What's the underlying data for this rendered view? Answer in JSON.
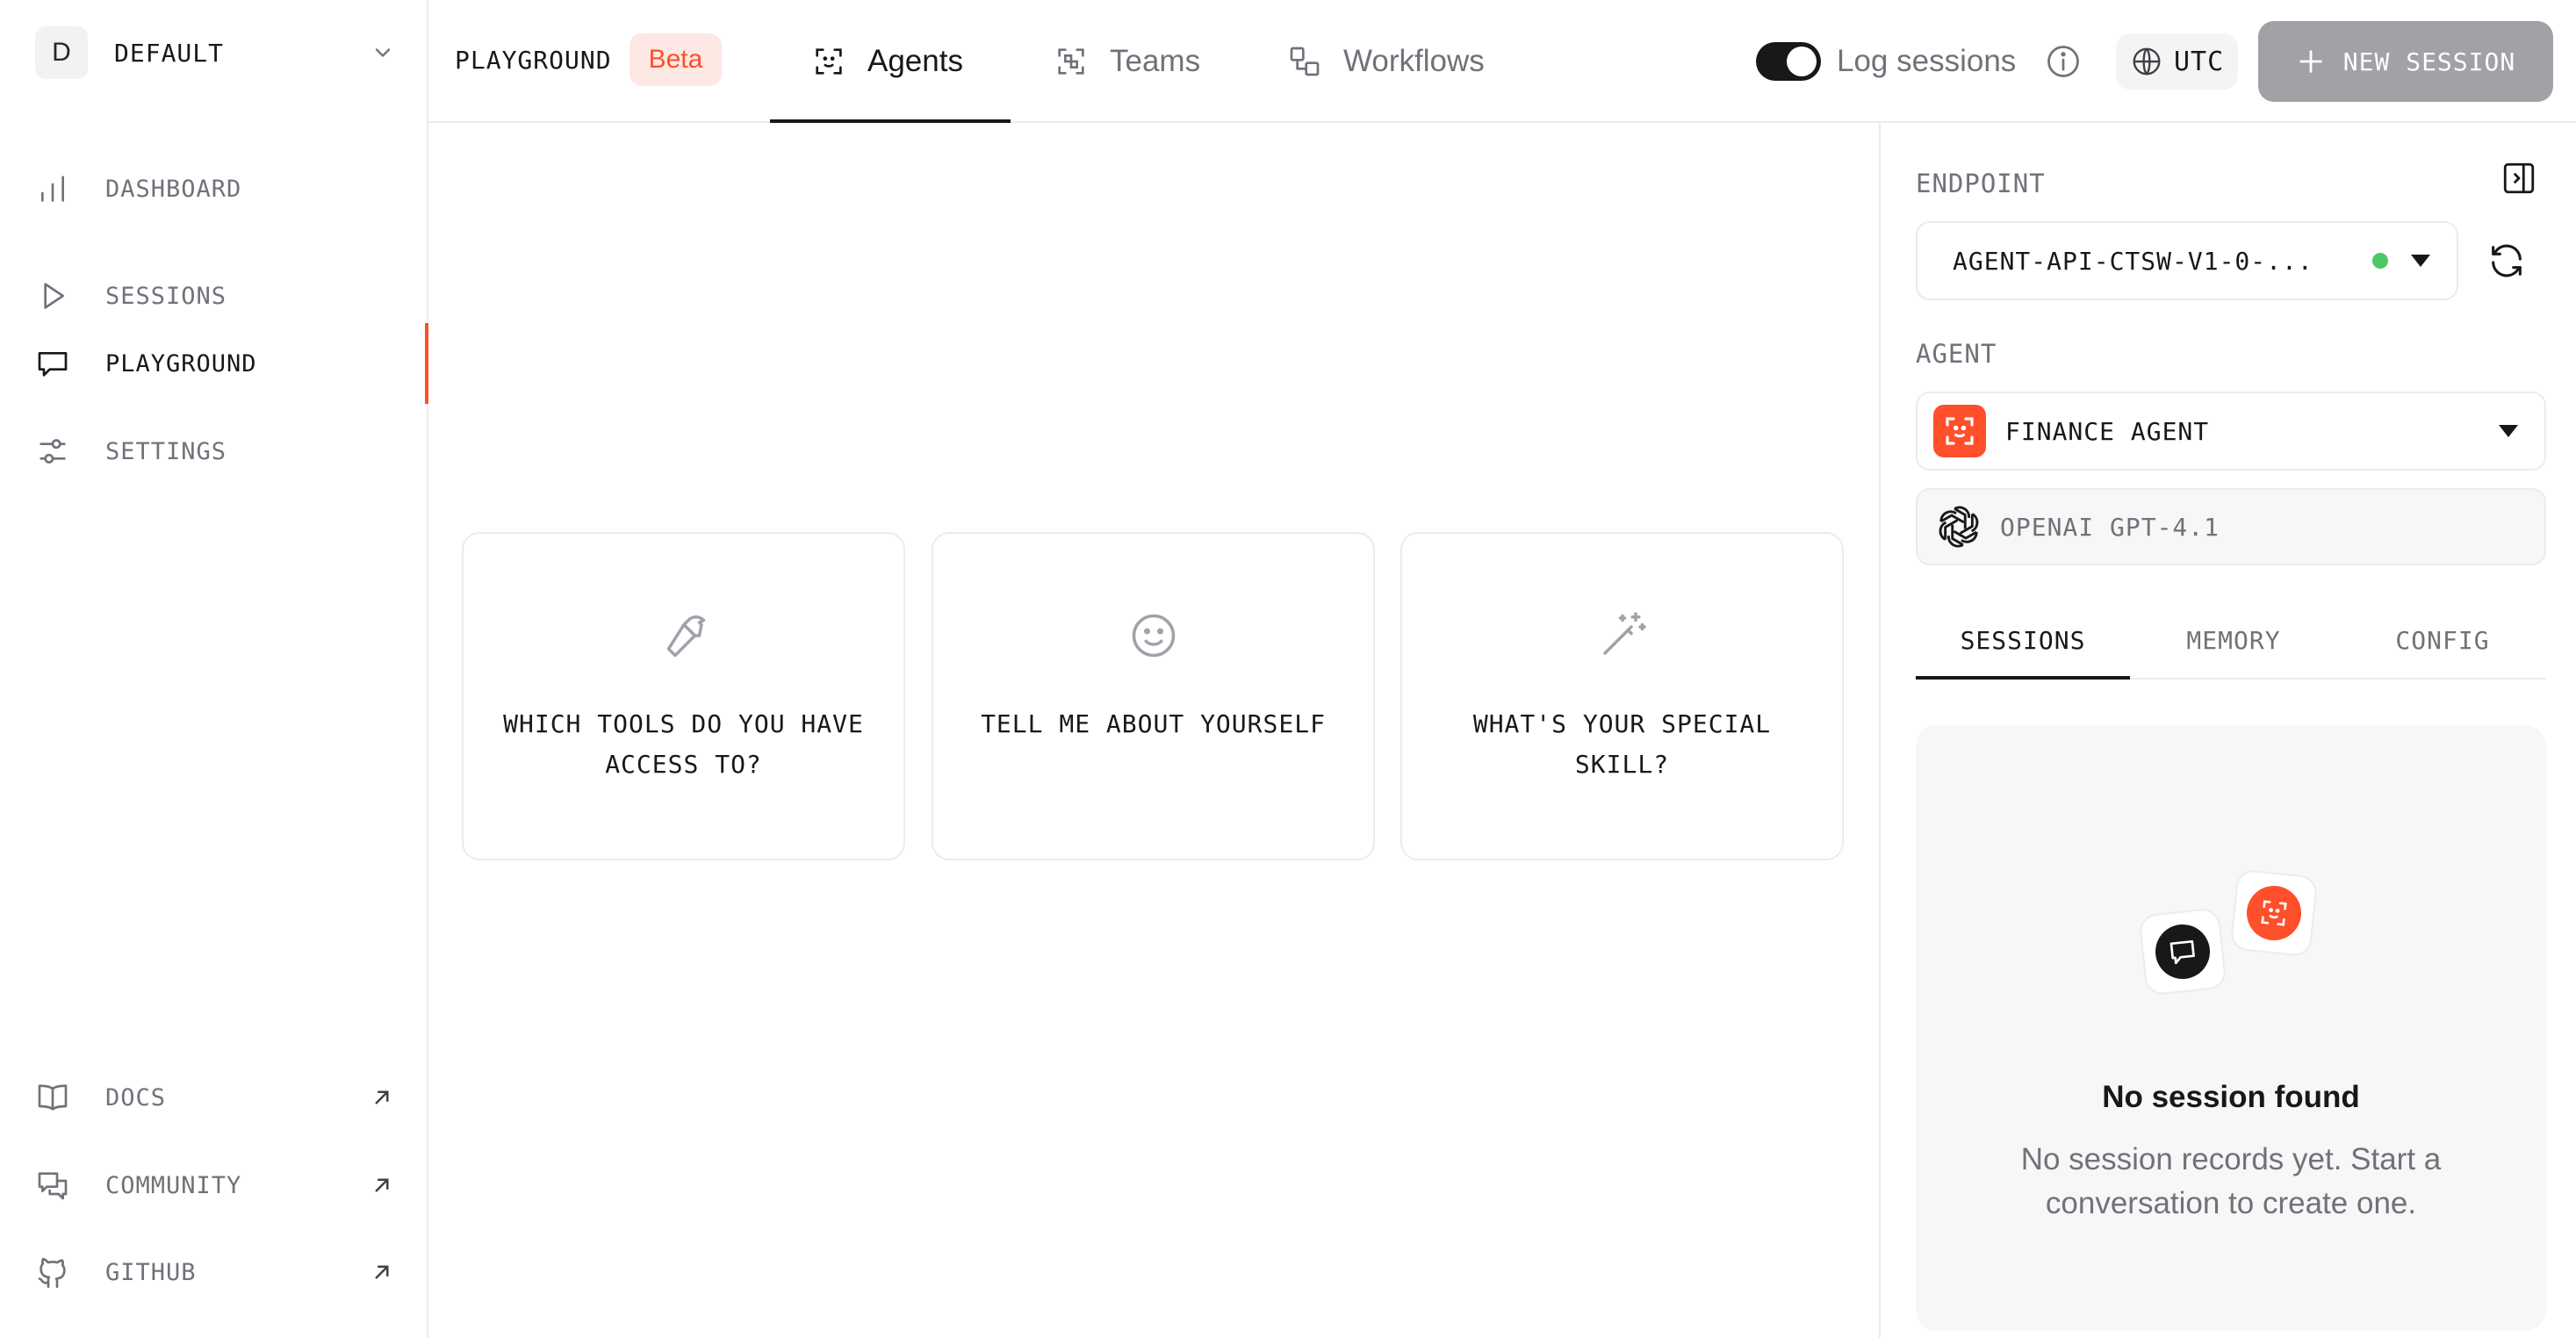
{
  "sidebar": {
    "workspace": {
      "initial": "D",
      "name": "DEFAULT"
    },
    "nav": [
      {
        "label": "DASHBOARD",
        "icon": "bar-chart-icon"
      },
      {
        "label": "SESSIONS",
        "icon": "play-icon"
      },
      {
        "label": "PLAYGROUND",
        "icon": "chat-bubble-icon",
        "active": true
      },
      {
        "label": "SETTINGS",
        "icon": "sliders-icon"
      }
    ],
    "footer_links": [
      {
        "label": "DOCS",
        "icon": "book-icon"
      },
      {
        "label": "COMMUNITY",
        "icon": "messages-icon"
      },
      {
        "label": "GITHUB",
        "icon": "github-icon"
      }
    ]
  },
  "header": {
    "breadcrumb": "PLAYGROUND",
    "badge": "Beta",
    "tabs": [
      {
        "label": "Agents",
        "icon": "agent-scan-icon",
        "active": true
      },
      {
        "label": "Teams",
        "icon": "teams-icon"
      },
      {
        "label": "Workflows",
        "icon": "workflow-icon"
      }
    ],
    "log_sessions": {
      "label": "Log sessions",
      "enabled": true
    },
    "timezone": "UTC",
    "new_session": "NEW SESSION"
  },
  "main": {
    "suggestions": [
      {
        "text": "WHICH TOOLS DO YOU HAVE ACCESS TO?",
        "icon": "hammer-icon"
      },
      {
        "text": "TELL ME ABOUT YOURSELF",
        "icon": "smile-icon"
      },
      {
        "text": "WHAT'S YOUR SPECIAL SKILL?",
        "icon": "magic-wand-icon"
      }
    ]
  },
  "panel": {
    "endpoint_label": "ENDPOINT",
    "endpoint_value": "AGENT-API-CTSW-V1-0-...",
    "endpoint_status": "online",
    "agent_label": "AGENT",
    "agent_value": "FINANCE AGENT",
    "model_value": "OPENAI GPT-4.1",
    "tabs": [
      {
        "label": "SESSIONS",
        "active": true
      },
      {
        "label": "MEMORY"
      },
      {
        "label": "CONFIG"
      }
    ],
    "empty_title": "No session found",
    "empty_desc": "No session records yet. Start a conversation to create one."
  },
  "colors": {
    "accent": "#ff4f2b",
    "badge_bg": "#fde8e3",
    "status_online": "#4cc866",
    "button_disabled": "#a1a1a6",
    "text_primary": "#18181b",
    "text_muted": "#71717a"
  }
}
